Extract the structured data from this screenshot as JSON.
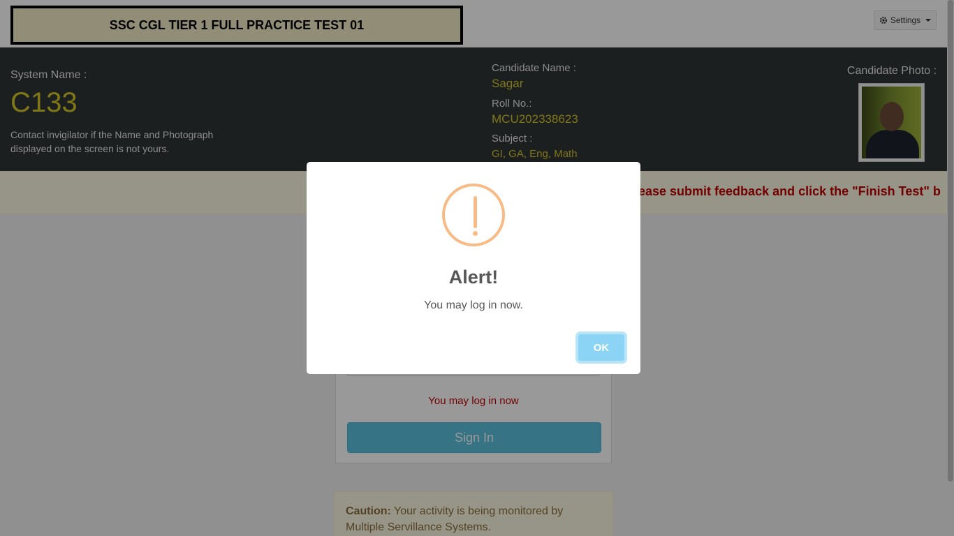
{
  "header": {
    "test_title": "SSC CGL TIER 1 FULL PRACTICE TEST 01",
    "settings_label": "Settings",
    "settings_icon": "gear-icon"
  },
  "system": {
    "label": "System Name :",
    "value": "C133",
    "note": "Contact invigilator if the Name and Photograph displayed on the screen is not yours."
  },
  "candidate": {
    "name_label": "Candidate Name :",
    "name": "Sagar",
    "roll_label": "Roll No.:",
    "roll": "MCU202338623",
    "subject_label": "Subject :",
    "subject": "GI, GA, Eng, Math",
    "photo_label": "Candidate Photo :"
  },
  "marquee": {
    "text": "ease submit feedback and click the \"Finish Test\" b"
  },
  "login": {
    "message": "You may log in now",
    "signin_label": "Sign In"
  },
  "caution": {
    "label": "Caution:",
    "text": " Your activity is being monitored by Multiple Servillance Systems."
  },
  "modal": {
    "icon": "warning-icon",
    "title": "Alert!",
    "text": "You may log in now.",
    "ok_label": "OK"
  },
  "colors": {
    "accent_yellow": "#d6c62a",
    "alert_orange": "#f8bb86",
    "ok_blue": "#8cd4f5",
    "signin_blue": "#5bc0de",
    "warning_red": "#c00000"
  }
}
